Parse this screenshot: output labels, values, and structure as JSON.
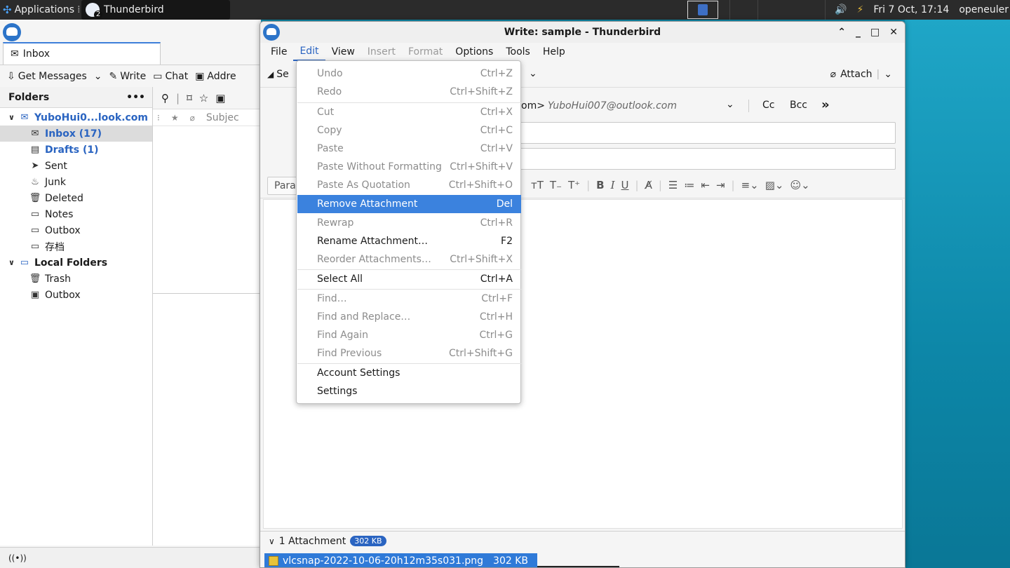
{
  "panel": {
    "applications": "Applications",
    "task_title": "Thunderbird",
    "task_count": "2",
    "datetime": "Fri  7 Oct, 17:14",
    "user": "openeuler"
  },
  "main": {
    "tab_label": "Inbox",
    "toolbar": {
      "get_messages": "Get Messages",
      "write": "Write",
      "chat": "Chat",
      "address": "Addre"
    },
    "folders_header": "Folders",
    "folders_menu": "•••",
    "folders": [
      {
        "label": "YuboHui0...look.com"
      },
      {
        "label": "Inbox (17)"
      },
      {
        "label": "Drafts (1)"
      },
      {
        "label": "Sent"
      },
      {
        "label": "Junk"
      },
      {
        "label": "Deleted"
      },
      {
        "label": "Notes"
      },
      {
        "label": "Outbox"
      },
      {
        "label": "存档"
      },
      {
        "label": "Local Folders"
      },
      {
        "label": "Trash"
      },
      {
        "label": "Outbox"
      }
    ],
    "column_subject": "Subjec"
  },
  "compose": {
    "title": "Write: sample - Thunderbird",
    "menus": {
      "file": "File",
      "edit": "Edit",
      "view": "View",
      "insert": "Insert",
      "format": "Format",
      "options": "Options",
      "tools": "Tools",
      "help": "Help"
    },
    "send_partial": "Se",
    "attach": "Attach",
    "from_partial": "om>",
    "from_address": "YuboHui007@outlook.com",
    "cc": "Cc",
    "bcc": "Bcc",
    "paragraph_partial": "Para",
    "attachments": {
      "summary": "1 Attachment",
      "size_badge": "302 KB",
      "file_name": "vlcsnap-2022-10-06-20h12m35s031.png",
      "file_size": "302 KB"
    }
  },
  "edit_menu": {
    "items": [
      {
        "label": "Undo",
        "shortcut": "Ctrl+Z"
      },
      {
        "label": "Redo",
        "shortcut": "Ctrl+Shift+Z"
      },
      {
        "label": "Cut",
        "shortcut": "Ctrl+X"
      },
      {
        "label": "Copy",
        "shortcut": "Ctrl+C"
      },
      {
        "label": "Paste",
        "shortcut": "Ctrl+V"
      },
      {
        "label": "Paste Without Formatting",
        "shortcut": "Ctrl+Shift+V"
      },
      {
        "label": "Paste As Quotation",
        "shortcut": "Ctrl+Shift+O"
      },
      {
        "label": "Remove Attachment",
        "shortcut": "Del"
      },
      {
        "label": "Rewrap",
        "shortcut": "Ctrl+R"
      },
      {
        "label": "Rename Attachment…",
        "shortcut": "F2"
      },
      {
        "label": "Reorder Attachments…",
        "shortcut": "Ctrl+Shift+X"
      },
      {
        "label": "Select All",
        "shortcut": "Ctrl+A"
      },
      {
        "label": "Find…",
        "shortcut": "Ctrl+F"
      },
      {
        "label": "Find and Replace…",
        "shortcut": "Ctrl+H"
      },
      {
        "label": "Find Again",
        "shortcut": "Ctrl+G"
      },
      {
        "label": "Find Previous",
        "shortcut": "Ctrl+Shift+G"
      },
      {
        "label": "Account Settings",
        "shortcut": ""
      },
      {
        "label": "Settings",
        "shortcut": ""
      }
    ]
  },
  "colors": {
    "accent": "#3b82de",
    "link_blue": "#2a64c1",
    "desktop": "#0e8fb0"
  }
}
